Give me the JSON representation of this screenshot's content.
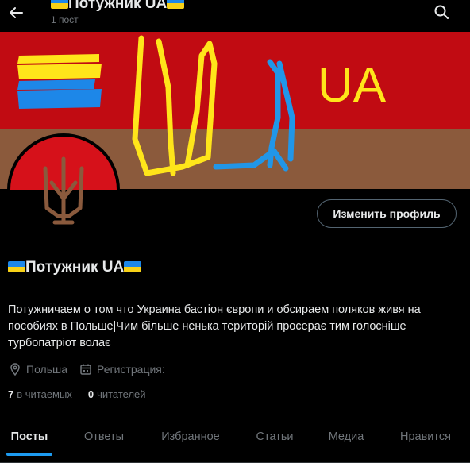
{
  "header": {
    "title": "Потужник UA",
    "post_count": "1 пост"
  },
  "icons": {
    "back": "arrow-left-icon",
    "search": "search-icon",
    "location": "location-pin-icon",
    "calendar": "calendar-icon"
  },
  "profile": {
    "display_name": "Потужник UA",
    "edit_button": "Изменить профиль",
    "bio": "Потужничаем о том что Украина бастіон європи и обсираем поляков живя на пособиях в Польше|Чим більше ненька територій просерає тим голосніше турбопатріот волає",
    "location": "Польша",
    "registration": "Регистрация:",
    "following_count": "7",
    "following_label": "в читаемых",
    "followers_count": "0",
    "followers_label": "читателей"
  },
  "banner": {
    "text": "UA",
    "colors": {
      "red": "#c10b12",
      "brown": "#8b5a3c",
      "yellow": "#ffe51a",
      "blue": "#2196e8"
    }
  },
  "tabs": [
    {
      "label": "Посты",
      "active": true
    },
    {
      "label": "Ответы",
      "active": false
    },
    {
      "label": "Избранное",
      "active": false
    },
    {
      "label": "Статьи",
      "active": false
    },
    {
      "label": "Медиа",
      "active": false
    },
    {
      "label": "Нравится",
      "active": false
    }
  ],
  "colors": {
    "accent": "#1d9bf0",
    "background": "#000000",
    "text": "#e7e9ea",
    "muted": "#71767b",
    "border": "#536471"
  }
}
